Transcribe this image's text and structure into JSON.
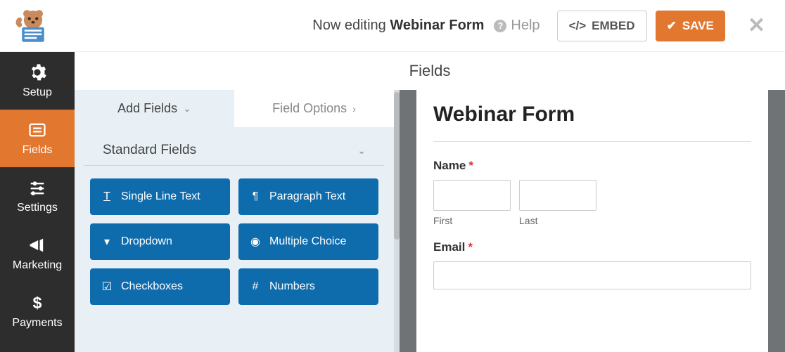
{
  "header": {
    "editing_prefix": "Now editing ",
    "form_name": "Webinar Form",
    "help": "Help",
    "embed": "EMBED",
    "save": "SAVE"
  },
  "sidebar": {
    "items": [
      {
        "label": "Setup"
      },
      {
        "label": "Fields"
      },
      {
        "label": "Settings"
      },
      {
        "label": "Marketing"
      },
      {
        "label": "Payments"
      }
    ]
  },
  "panel": {
    "title": "Fields",
    "tabs": {
      "add": "Add Fields",
      "options": "Field Options"
    },
    "section": "Standard Fields",
    "fields": [
      {
        "label": "Single Line Text"
      },
      {
        "label": "Paragraph Text"
      },
      {
        "label": "Dropdown"
      },
      {
        "label": "Multiple Choice"
      },
      {
        "label": "Checkboxes"
      },
      {
        "label": "Numbers"
      }
    ]
  },
  "preview": {
    "title": "Webinar Form",
    "name_label": "Name",
    "first": "First",
    "last": "Last",
    "email_label": "Email"
  }
}
